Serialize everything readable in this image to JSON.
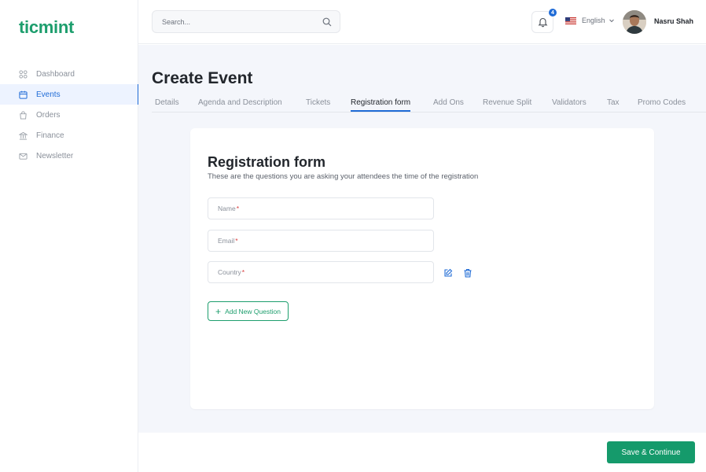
{
  "app": {
    "logo": "ticmint"
  },
  "sidebar": {
    "items": [
      {
        "label": "Dashboard",
        "icon": "grid-icon"
      },
      {
        "label": "Events",
        "icon": "calendar-icon",
        "active": true
      },
      {
        "label": "Orders",
        "icon": "bag-icon"
      },
      {
        "label": "Finance",
        "icon": "bank-icon"
      },
      {
        "label": "Newsletter",
        "icon": "mail-icon"
      }
    ]
  },
  "header": {
    "search_placeholder": "Search...",
    "notification_count": "4",
    "language": "English",
    "user_name": "Nasru Shah"
  },
  "page": {
    "title": "Create Event",
    "tabs": [
      "Details",
      "Agenda and Description",
      "Tickets",
      "Registration form",
      "Add Ons",
      "Revenue Split",
      "Validators",
      "Tax",
      "Promo Codes"
    ],
    "active_tab": "Registration form"
  },
  "form": {
    "title": "Registration form",
    "subtitle": "These are the questions you are asking your attendees the time of the registration",
    "fields": [
      {
        "label": "Name",
        "required": "*"
      },
      {
        "label": "Email",
        "required": "*"
      },
      {
        "label": "Country",
        "required": "*"
      }
    ],
    "add_button": "Add New Question"
  },
  "footer": {
    "save_button": "Save & Continue"
  },
  "colors": {
    "brand": "#1d9e6d",
    "accent": "#1f6bd6",
    "required": "#d93b3b"
  }
}
